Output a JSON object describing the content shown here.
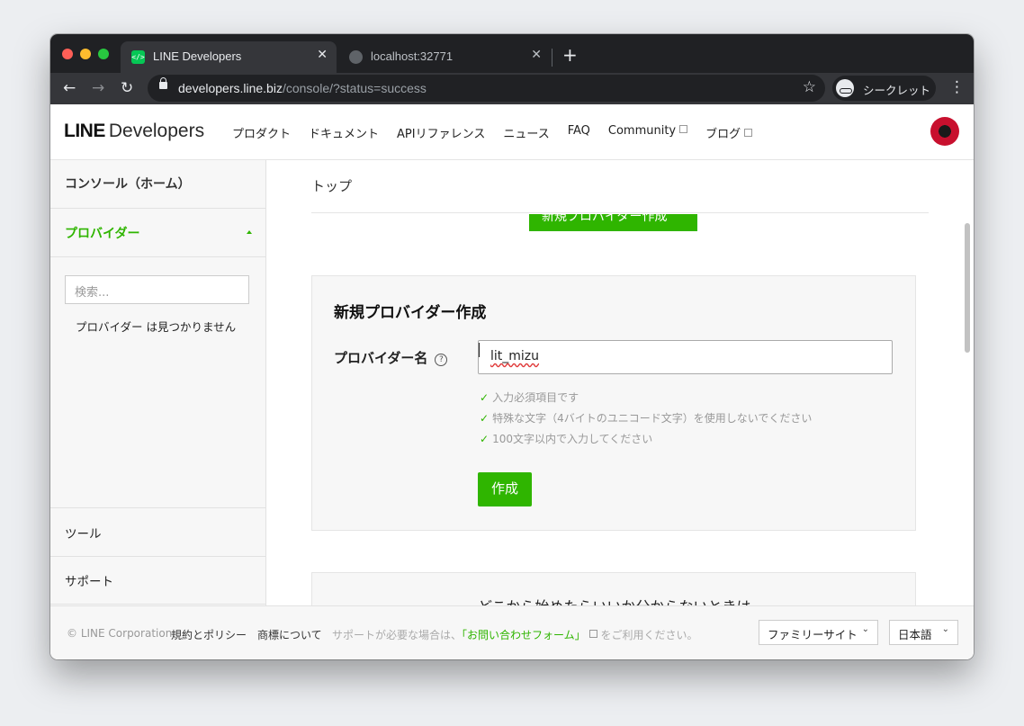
{
  "browser": {
    "tabs": [
      {
        "title": "LINE Developers",
        "favicon": "</>"
      },
      {
        "title": "localhost:32771"
      }
    ],
    "url_host": "developers.line.biz",
    "url_path": "/console/?status=success",
    "incognito_label": "シークレット"
  },
  "header": {
    "logo_bold": "LINE",
    "logo_rest": "Developers",
    "nav": [
      "プロダクト",
      "ドキュメント",
      "APIリファレンス",
      "ニュース",
      "FAQ",
      "Community",
      "ブログ"
    ]
  },
  "sidebar": {
    "home": "コンソール（ホーム）",
    "providers": "プロバイダー",
    "search_placeholder": "検索...",
    "empty_message": "プロバイダー は見つかりません",
    "tools": "ツール",
    "support": "サポート"
  },
  "main": {
    "breadcrumb": "トップ",
    "partial_button": "新規プロバイダー作成",
    "panel_title": "新規プロバイダー作成",
    "field_label": "プロバイダー名",
    "help_glyph": "?",
    "input_value": "lit_mizu",
    "rules": [
      "入力必須項目です",
      "特殊な文字（4バイトのユニコード文字）を使用しないでください",
      "100文字以内で入力してください"
    ],
    "create_button": "作成",
    "next_panel_title": "どこから始めたらいいか分からないときは"
  },
  "footer": {
    "copyright": "© LINE Corporation",
    "terms": "規約とポリシー",
    "trademark": "商標について",
    "support_pre": "サポートが必要な場合は、",
    "support_link": "「お問い合わせフォーム」",
    "support_post": "をご利用ください。",
    "family_site": "ファミリーサイト",
    "language": "日本語"
  },
  "colors": {
    "brand_green": "#2fb500",
    "chrome_dark": "#202124"
  }
}
